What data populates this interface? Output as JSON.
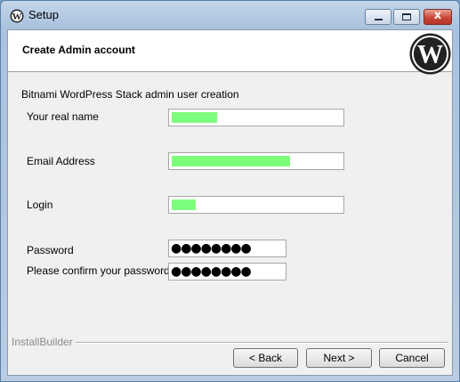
{
  "window": {
    "title": "Setup",
    "app_icon": "wordpress-icon",
    "minimize_icon": "minimize-icon",
    "maximize_icon": "maximize-icon",
    "close_icon": "close-icon",
    "close_glyph": "x"
  },
  "header": {
    "title": "Create Admin account",
    "logo": "wordpress-logo"
  },
  "intro": "Bitnami WordPress Stack admin user creation",
  "fields": {
    "real_name": {
      "label": "Your real name",
      "value_redacted": true
    },
    "email": {
      "label": "Email Address",
      "value_redacted": true
    },
    "login": {
      "label": "Login",
      "value_redacted": true
    },
    "password": {
      "label": "Password",
      "masked": "●●●●●●●●"
    },
    "confirm_password": {
      "label": "Please confirm your password",
      "masked": "●●●●●●●●"
    }
  },
  "redaction_color": "#7dff7d",
  "footer": {
    "brand": "InstallBuilder"
  },
  "buttons": {
    "back": "< Back",
    "next": "Next >",
    "cancel": "Cancel"
  }
}
